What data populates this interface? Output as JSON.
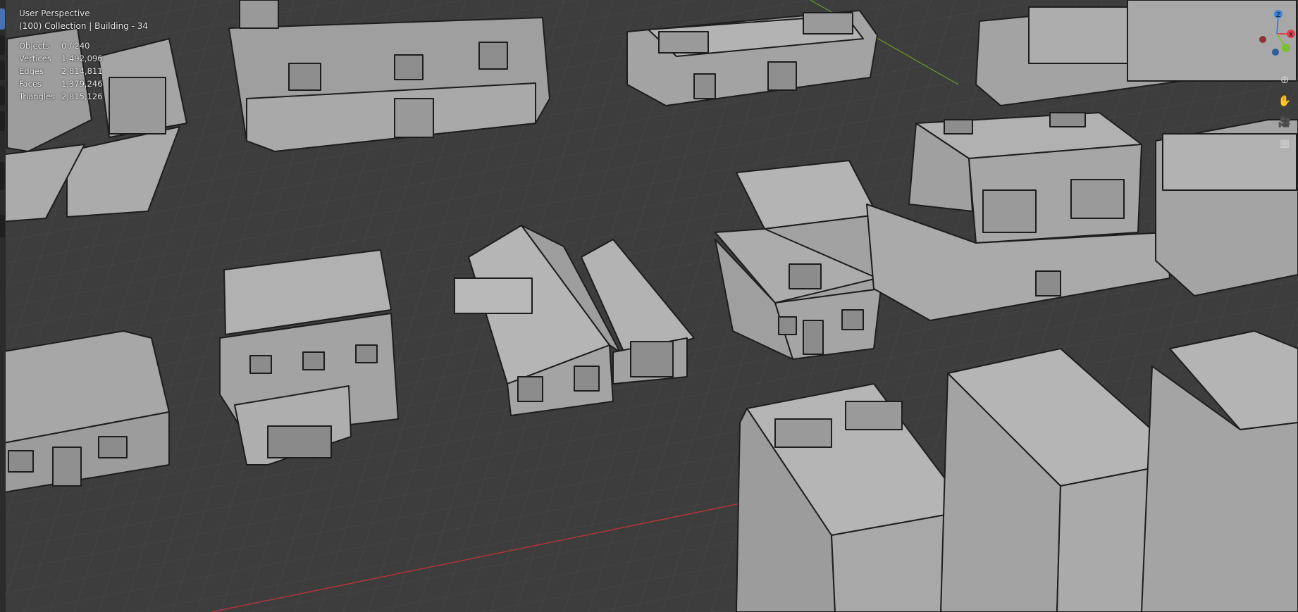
{
  "viewport": {
    "view_name": "User Perspective",
    "collection_info": "(100) Collection | Building - 34"
  },
  "stats": [
    {
      "label": "Objects",
      "value": "0 / 240"
    },
    {
      "label": "Vertices",
      "value": "1,492,096"
    },
    {
      "label": "Edges",
      "value": "2,814,811"
    },
    {
      "label": "Faces",
      "value": "1,379,246"
    },
    {
      "label": "Triangles",
      "value": "2,815,126"
    }
  ],
  "gizmo": {
    "axis_labels": [
      "Z",
      "X"
    ],
    "x_color": "#e0404d",
    "y_color": "#7bbf2c",
    "z_color": "#3f84d9"
  },
  "nav_buttons": [
    {
      "name": "zoom-icon",
      "glyph": "⊕"
    },
    {
      "name": "pan-hand-icon",
      "glyph": "✋"
    },
    {
      "name": "camera-view-icon",
      "glyph": "🎥"
    },
    {
      "name": "perspective-grid-icon",
      "glyph": "▦"
    }
  ],
  "colors": {
    "grid_bg": "#3d3d3d",
    "building": "#a6a6a6",
    "edge": "#1d1d1d",
    "x_axis": "#b0353c",
    "y_axis": "#6d9a2d"
  }
}
